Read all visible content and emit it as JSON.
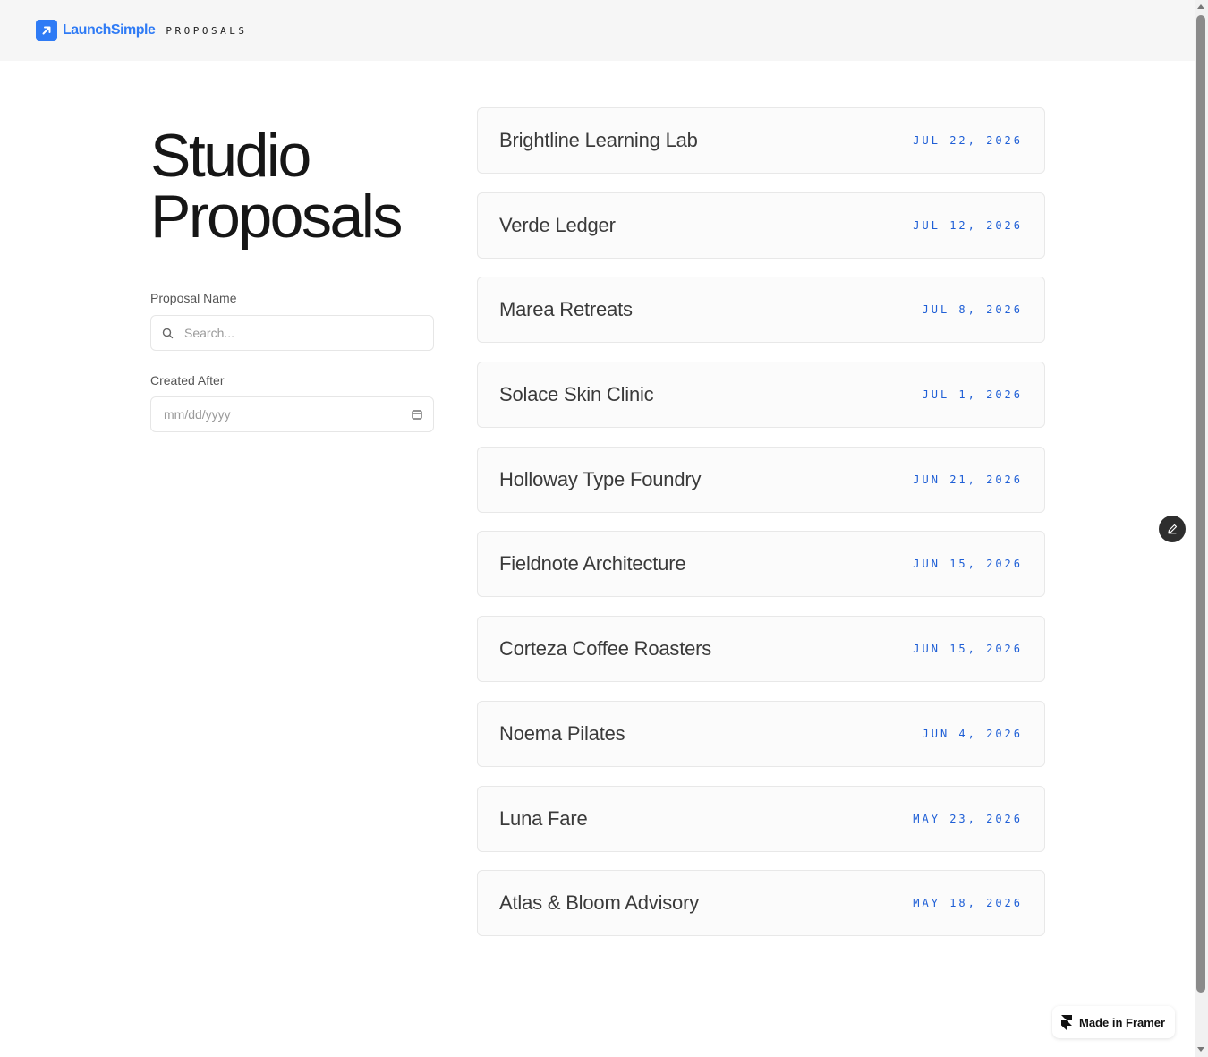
{
  "header": {
    "brand_name": "LaunchSimple",
    "nav_label": "PROPOSALS"
  },
  "title": {
    "line1": "Studio",
    "line2": "Proposals"
  },
  "filters": {
    "name_label": "Proposal Name",
    "name_placeholder": "Search...",
    "name_value": "",
    "date_label": "Created After",
    "date_placeholder": "mm/dd/yyyy",
    "date_value": ""
  },
  "proposals": [
    {
      "name": "Brightline Learning Lab",
      "date": "JUL 22, 2026"
    },
    {
      "name": "Verde Ledger",
      "date": "JUL 12, 2026"
    },
    {
      "name": "Marea Retreats",
      "date": "JUL 8, 2026"
    },
    {
      "name": "Solace Skin Clinic",
      "date": "JUL 1, 2026"
    },
    {
      "name": "Holloway Type Foundry",
      "date": "JUN 21, 2026"
    },
    {
      "name": "Fieldnote Architecture",
      "date": "JUN 15, 2026"
    },
    {
      "name": "Corteza Coffee Roasters",
      "date": "JUN 15, 2026"
    },
    {
      "name": "Noema Pilates",
      "date": "JUN 4, 2026"
    },
    {
      "name": "Luna Fare",
      "date": "MAY 23, 2026"
    },
    {
      "name": "Atlas & Bloom Advisory",
      "date": "MAY 18, 2026"
    }
  ],
  "badge": {
    "label": "Made in Framer",
    "icon": "framer-logo-icon"
  },
  "icons": {
    "brand": "arrow-up-right-icon",
    "search": "search-icon",
    "calendar": "calendar-icon",
    "edit": "pencil-icon"
  },
  "colors": {
    "accent": "#2f7bf5",
    "date_text": "#1f5fd6",
    "header_bg": "#f6f6f6",
    "card_bg": "#fbfbfb"
  }
}
